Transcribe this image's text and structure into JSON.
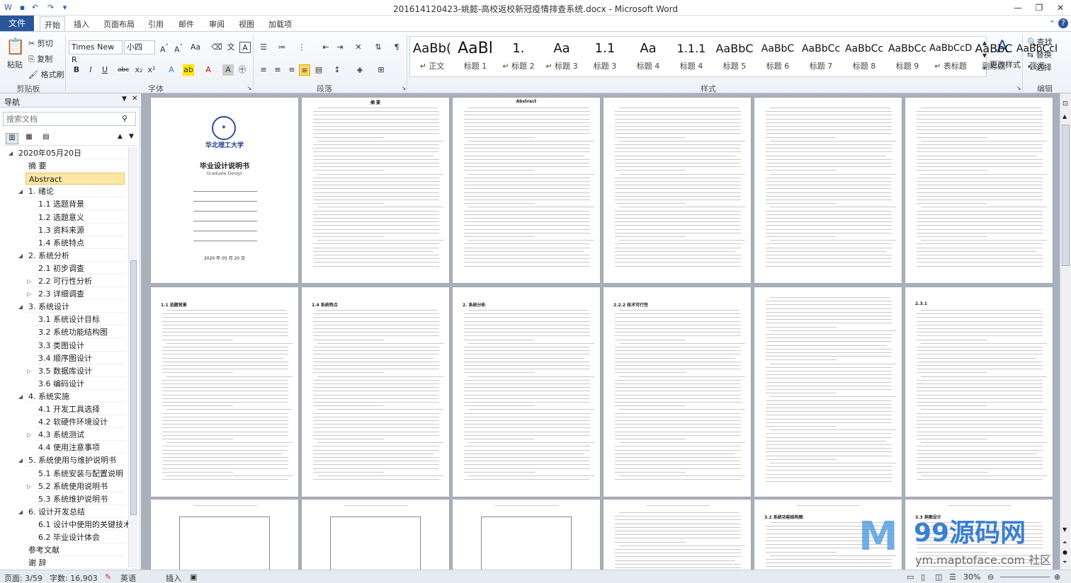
{
  "title_bar": {
    "title": "201614120423-姚懿-高校返校新冠疫情排查系统.docx  -  Microsoft Word",
    "controls": [
      "minimize",
      "restore",
      "close"
    ]
  },
  "quick_access": [
    "save-icon",
    "undo-icon",
    "redo-icon",
    "customize-icon"
  ],
  "tabs": {
    "file": "文件",
    "items": [
      "开始",
      "插入",
      "页面布局",
      "引用",
      "邮件",
      "审阅",
      "视图",
      "加载项"
    ],
    "active": "开始"
  },
  "ribbon": {
    "clipboard": {
      "label": "剪贴板",
      "paste": "粘贴",
      "cut": "剪切",
      "copy": "复制",
      "format_painter": "格式刷"
    },
    "font": {
      "label": "字体",
      "font_name": "Times New R",
      "font_size": "小四"
    },
    "paragraph": {
      "label": "段落"
    },
    "styles": {
      "label": "样式",
      "items": [
        {
          "preview": "AaBb(",
          "name": "↵ 正文"
        },
        {
          "preview": "AaBl",
          "name": "标题 1"
        },
        {
          "preview": "1.",
          "name": "↵ 标题 2"
        },
        {
          "preview": "Aa",
          "name": "↵ 标题 3"
        },
        {
          "preview": "1.1",
          "name": "标题 3"
        },
        {
          "preview": "Aa",
          "name": "标题 4"
        },
        {
          "preview": "1.1.1",
          "name": "标题 4"
        },
        {
          "preview": "AaBbC",
          "name": "标题 5"
        },
        {
          "preview": "AaBbC",
          "name": "标题 6"
        },
        {
          "preview": "AaBbCc",
          "name": "标题 7"
        },
        {
          "preview": "AaBbCc",
          "name": "标题 8"
        },
        {
          "preview": "AaBbCc",
          "name": "标题 9"
        },
        {
          "preview": "AaBbCcD",
          "name": "↵ 表标题"
        },
        {
          "preview": "AaBbC",
          "name": "副标题"
        },
        {
          "preview": "AaBbCcI",
          "name": "强调"
        }
      ],
      "change_styles": "更改样式"
    },
    "editing": {
      "label": "编辑",
      "find": "查找",
      "replace": "替换",
      "select": "选择"
    }
  },
  "nav": {
    "title": "导航",
    "search_placeholder": "搜索文档",
    "items": [
      {
        "text": "2020年05月20日",
        "level": 0,
        "arrow": "◢"
      },
      {
        "text": "摘 要",
        "level": 1,
        "arrow": ""
      },
      {
        "text": "Abstract",
        "level": 1,
        "arrow": "",
        "selected": true
      },
      {
        "text": "1. 绪论",
        "level": 1,
        "arrow": "◢"
      },
      {
        "text": "1.1 选题背景",
        "level": 2,
        "arrow": ""
      },
      {
        "text": "1.2 选题意义",
        "level": 2,
        "arrow": ""
      },
      {
        "text": "1.3 资料来源",
        "level": 2,
        "arrow": ""
      },
      {
        "text": "1.4 系统特点",
        "level": 2,
        "arrow": ""
      },
      {
        "text": "2. 系统分析",
        "level": 1,
        "arrow": "◢"
      },
      {
        "text": "2.1 初步调查",
        "level": 2,
        "arrow": ""
      },
      {
        "text": "2.2 可行性分析",
        "level": 2,
        "arrow": "▷"
      },
      {
        "text": "2.3 详细调查",
        "level": 2,
        "arrow": "▷"
      },
      {
        "text": "3. 系统设计",
        "level": 1,
        "arrow": "◢"
      },
      {
        "text": "3.1 系统设计目标",
        "level": 2,
        "arrow": ""
      },
      {
        "text": "3.2 系统功能结构图",
        "level": 2,
        "arrow": ""
      },
      {
        "text": "3.3 类图设计",
        "level": 2,
        "arrow": ""
      },
      {
        "text": "3.4 顺序图设计",
        "level": 2,
        "arrow": ""
      },
      {
        "text": "3.5 数据库设计",
        "level": 2,
        "arrow": "▷"
      },
      {
        "text": "3.6 编码设计",
        "level": 2,
        "arrow": ""
      },
      {
        "text": "4. 系统实施",
        "level": 1,
        "arrow": "◢"
      },
      {
        "text": "4.1 开发工具选择",
        "level": 2,
        "arrow": ""
      },
      {
        "text": "4.2 软硬件环境设计",
        "level": 2,
        "arrow": ""
      },
      {
        "text": "4.3 系统测试",
        "level": 2,
        "arrow": "▷"
      },
      {
        "text": "4.4 使用注意事项",
        "level": 2,
        "arrow": ""
      },
      {
        "text": "5. 系统使用与维护说明书",
        "level": 1,
        "arrow": "◢"
      },
      {
        "text": "5.1 系统安装与配置说明",
        "level": 2,
        "arrow": ""
      },
      {
        "text": "5.2 系统使用说明书",
        "level": 2,
        "arrow": "▷"
      },
      {
        "text": "5.3 系统维护说明书",
        "level": 2,
        "arrow": ""
      },
      {
        "text": "6. 设计开发总结",
        "level": 1,
        "arrow": "◢"
      },
      {
        "text": "6.1 设计中使用的关键技术",
        "level": 2,
        "arrow": ""
      },
      {
        "text": "6.2 毕业设计体会",
        "level": 2,
        "arrow": ""
      },
      {
        "text": "参考文献",
        "level": 1,
        "arrow": ""
      },
      {
        "text": "谢 辞",
        "level": 1,
        "arrow": ""
      }
    ]
  },
  "pages": {
    "p1": {
      "title": "毕业设计说明书",
      "subtitle": "Graduate Design",
      "date": "2020 年 05 月 20 日",
      "school": "华北理工大学"
    },
    "p2": {
      "heading": "摘 要"
    },
    "p3": {
      "heading": "Abstract"
    },
    "p6": {
      "heading": "1.1 选题背景"
    },
    "p7": {
      "heading": "1.2 选题意义"
    },
    "p8": {
      "heading": "1.4 系统特点"
    },
    "p9": {
      "heading": "2. 系统分析"
    },
    "p10": {
      "heading": "2.2.2 技术可行性"
    },
    "p12": {
      "heading": "2.3.1"
    },
    "p16": {
      "heading": "3.2 系统功能结构图"
    },
    "p17": {
      "heading": "3.3 类图设计"
    }
  },
  "status": {
    "page": "页面: 3/59",
    "words": "字数: 16,903",
    "lang": "英语",
    "mode": "插入",
    "zoom": "30%"
  },
  "watermark": {
    "text": "99源码网",
    "sub": "ym.maptoface.com 社区"
  }
}
